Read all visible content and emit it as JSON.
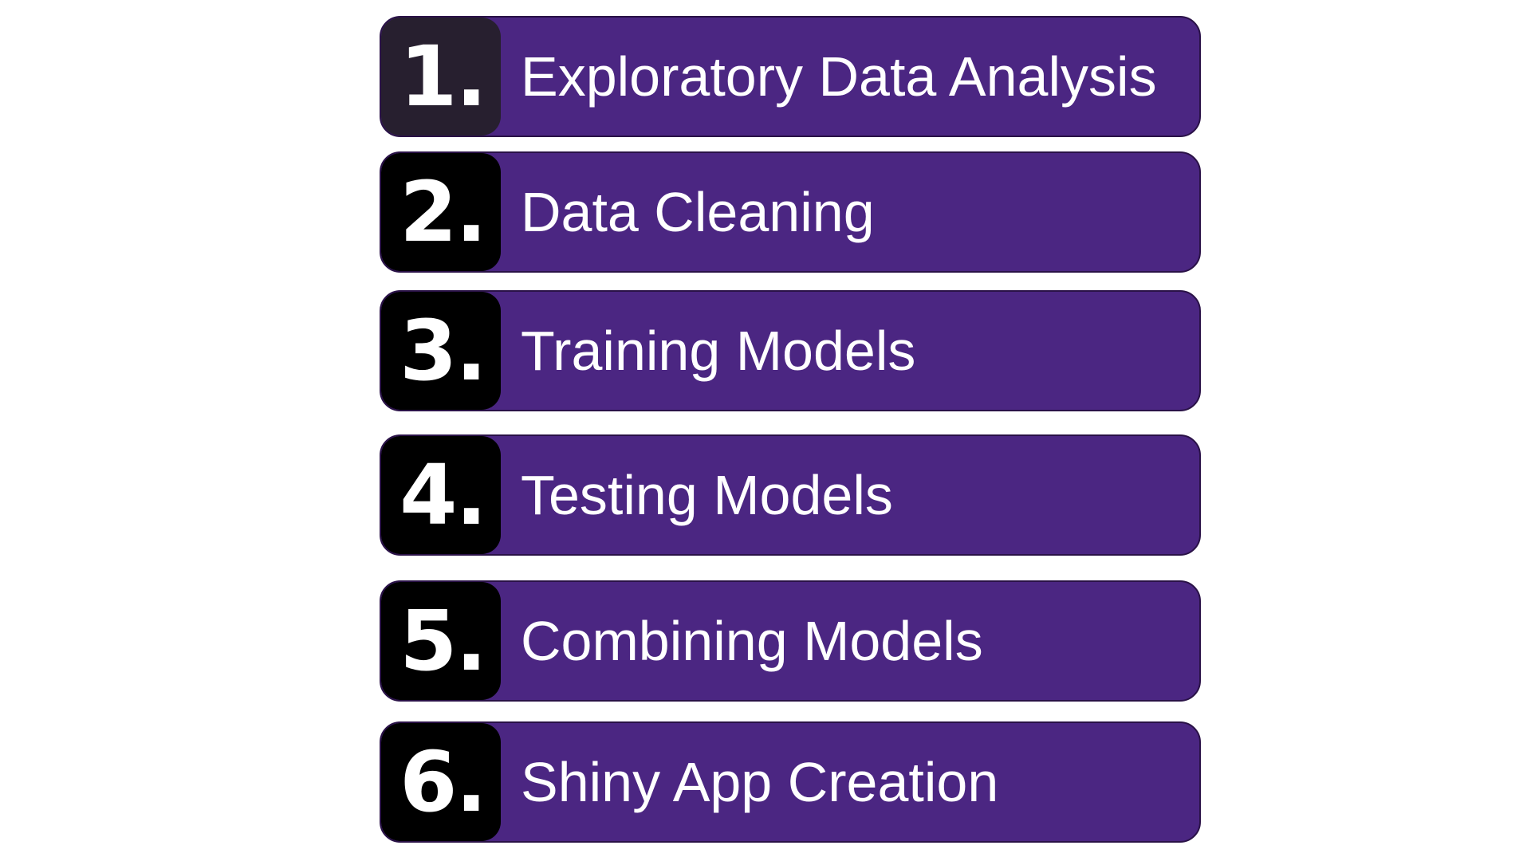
{
  "colors": {
    "bar_background": "#4b2682",
    "number_box_first": "#271f2f",
    "number_box": "#000000",
    "text": "#ffffff"
  },
  "steps": [
    {
      "number": "1.",
      "label": "Exploratory Data Analysis"
    },
    {
      "number": "2.",
      "label": "Data Cleaning"
    },
    {
      "number": "3.",
      "label": "Training Models"
    },
    {
      "number": "4.",
      "label": "Testing Models"
    },
    {
      "number": "5.",
      "label": "Combining Models"
    },
    {
      "number": "6.",
      "label": "Shiny App Creation"
    }
  ]
}
